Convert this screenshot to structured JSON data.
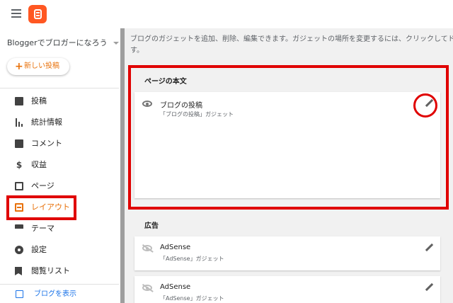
{
  "app": {
    "blog_name": "Bloggerでブロガーになろう",
    "new_post_label": "新しい投稿"
  },
  "sidebar": {
    "items": [
      {
        "label": "投稿",
        "icon": "posts-icon"
      },
      {
        "label": "統計情報",
        "icon": "stats-icon"
      },
      {
        "label": "コメント",
        "icon": "comment-icon"
      },
      {
        "label": "収益",
        "icon": "dollar-icon"
      },
      {
        "label": "ページ",
        "icon": "pages-icon"
      },
      {
        "label": "レイアウト",
        "icon": "layout-icon",
        "active": true
      },
      {
        "label": "テーマ",
        "icon": "theme-icon"
      },
      {
        "label": "設定",
        "icon": "gear-icon"
      },
      {
        "label": "閲覧リスト",
        "icon": "bookmark-icon"
      }
    ],
    "view_blog_label": "ブログを表示"
  },
  "main": {
    "info_line1": "ブログのガジェットを追加、削除、編集できます。ガジェットの場所を変更するには、クリックしてドラッグしま",
    "info_line2": "す。",
    "sections": [
      {
        "title": "ページの本文",
        "gadgets": [
          {
            "title": "ブログの投稿",
            "subtitle": "「ブログの投稿」ガジェット",
            "visible": true
          }
        ]
      },
      {
        "title": "広告",
        "gadgets": [
          {
            "title": "AdSense",
            "subtitle": "「AdSense」ガジェット",
            "visible": false
          },
          {
            "title": "AdSense",
            "subtitle": "「AdSense」ガジェット",
            "visible": false
          }
        ]
      }
    ]
  },
  "colors": {
    "accent": "#e8710a",
    "highlight": "#e00000",
    "logo": "#ff5722",
    "link": "#1a73e8"
  }
}
